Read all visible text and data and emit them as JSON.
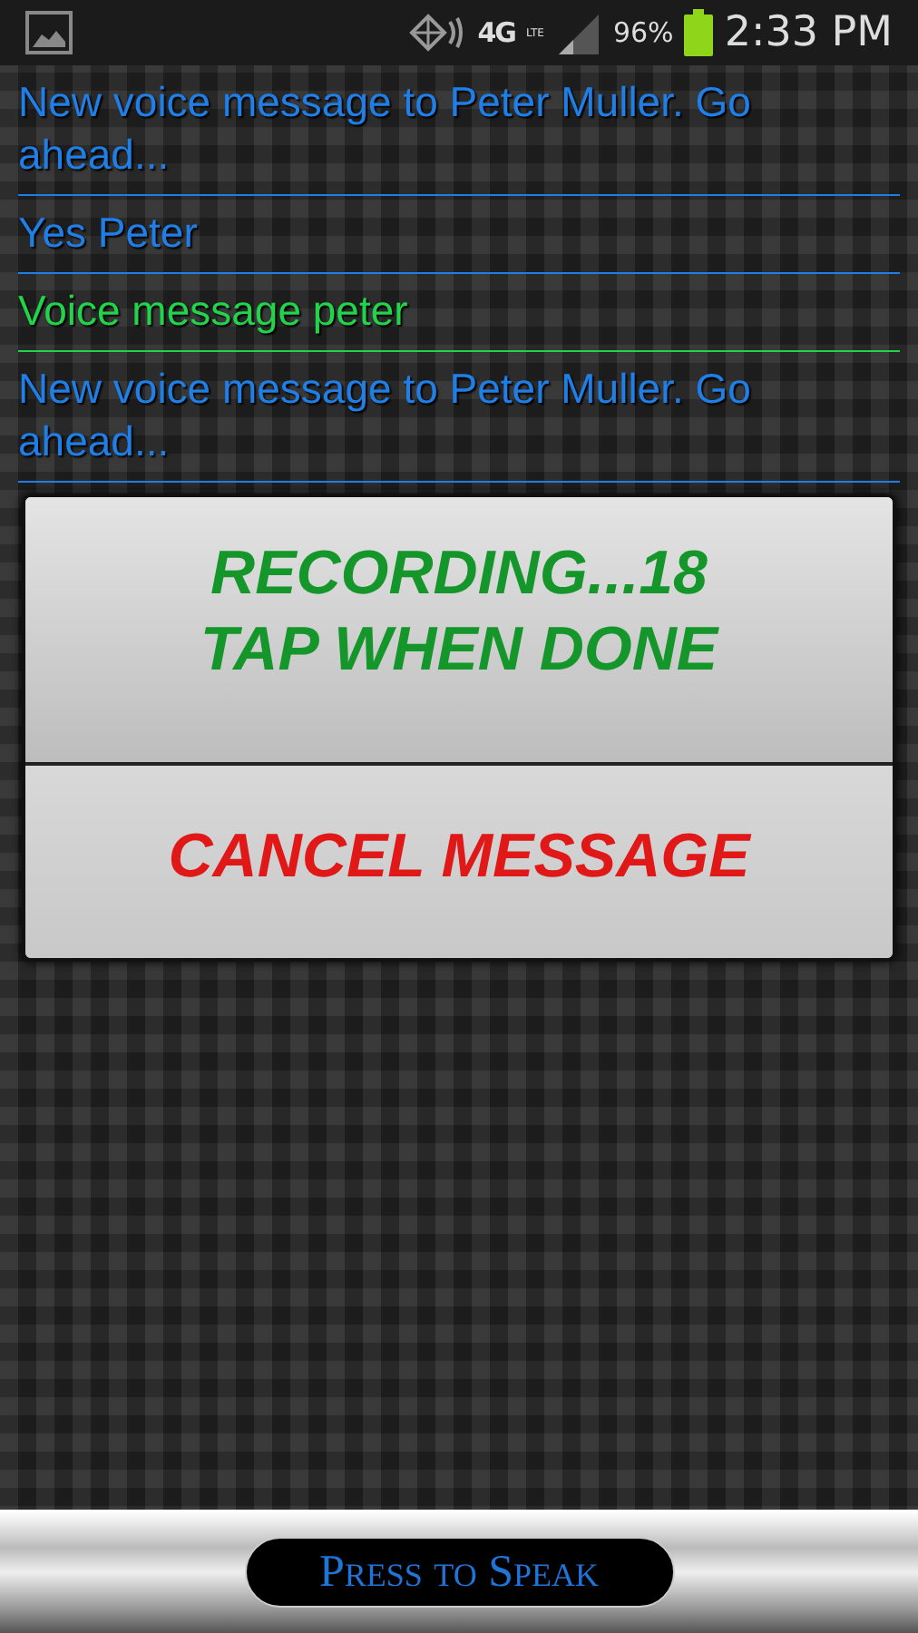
{
  "status_bar": {
    "network": "4G",
    "network_sub": "LTE",
    "battery": "96%",
    "time": "2:33 PM"
  },
  "messages": [
    {
      "text": "New voice message to Peter Muller. Go ahead...",
      "kind": "app"
    },
    {
      "text": "Yes Peter",
      "kind": "app"
    },
    {
      "text": "Voice message peter",
      "kind": "user"
    },
    {
      "text": "New voice message to Peter Muller. Go ahead...",
      "kind": "app"
    }
  ],
  "dialog": {
    "record_lines": [
      "RECORDING...18",
      "TAP WHEN DONE"
    ],
    "cancel": "CANCEL MESSAGE"
  },
  "speak_button": "Press to Speak"
}
